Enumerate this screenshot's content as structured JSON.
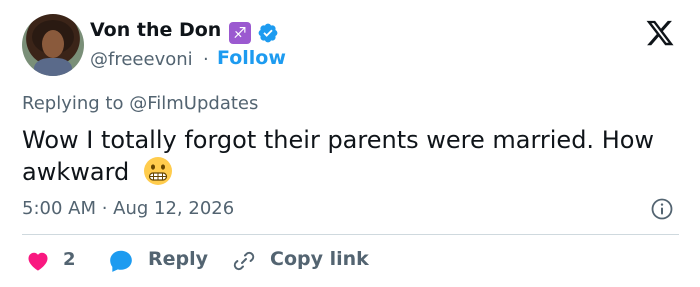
{
  "author": {
    "name": "Von the Don",
    "zodiac_glyph": "♐",
    "handle": "@freeevoni",
    "separator": "·",
    "follow_label": "Follow"
  },
  "reply_context": {
    "prefix": "Replying to",
    "mention": "@FilmUpdates"
  },
  "tweet": {
    "text": "Wow I totally forgot their parents were married. How awkward"
  },
  "meta": {
    "timestamp": "5:00 AM · Aug 12, 2026"
  },
  "actions": {
    "like_count": "2",
    "reply_label": "Reply",
    "copy_link_label": "Copy link"
  },
  "colors": {
    "accent": "#1d9bf0",
    "like": "#f91880",
    "reply_bubble": "#1d9bf0",
    "zodiac_bg": "#9b59d0",
    "text_primary": "#0f1419",
    "text_secondary": "#536471"
  },
  "icons": [
    "x-logo-icon",
    "verified-badge-icon",
    "sagittarius-icon",
    "grimacing-face-icon",
    "info-icon",
    "heart-icon",
    "reply-bubble-icon",
    "link-icon"
  ]
}
